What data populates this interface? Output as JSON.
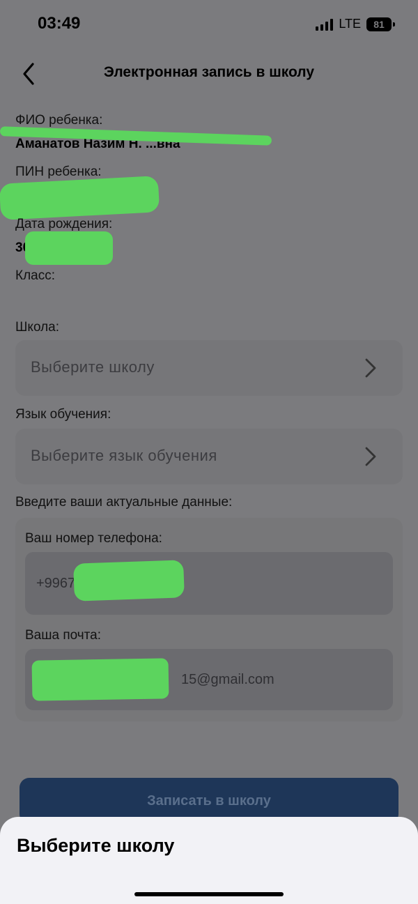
{
  "status_bar": {
    "time": "03:49",
    "network": "LTE",
    "battery": "81"
  },
  "header": {
    "title": "Электронная запись в школу"
  },
  "child": {
    "fio_label": "ФИО ребенка:",
    "fio_value": "Аманатов Назим Н. ...вна",
    "pin_label": "ПИН ребенка:",
    "pin_value": "",
    "dob_label": "Дата рождения:",
    "dob_value": "30.0",
    "class_label": "Класс:"
  },
  "school": {
    "label": "Школа:",
    "placeholder": "Выберите школу"
  },
  "language": {
    "label": "Язык обучения:",
    "placeholder": "Выберите язык обучения"
  },
  "contacts": {
    "section_label": "Введите ваши актуальные данные:",
    "phone_label": "Ваш номер телефона:",
    "phone_value": "+9967",
    "email_label": "Ваша почта:",
    "email_value": "15@gmail.com"
  },
  "submit": {
    "label": "Записать в школу"
  },
  "bottom_sheet": {
    "title": "Выберите школу"
  },
  "colors": {
    "overlay": "#7b7b7e",
    "redaction": "#5cd45e",
    "button": "#1e3658",
    "sheet": "#f2f2f6"
  }
}
